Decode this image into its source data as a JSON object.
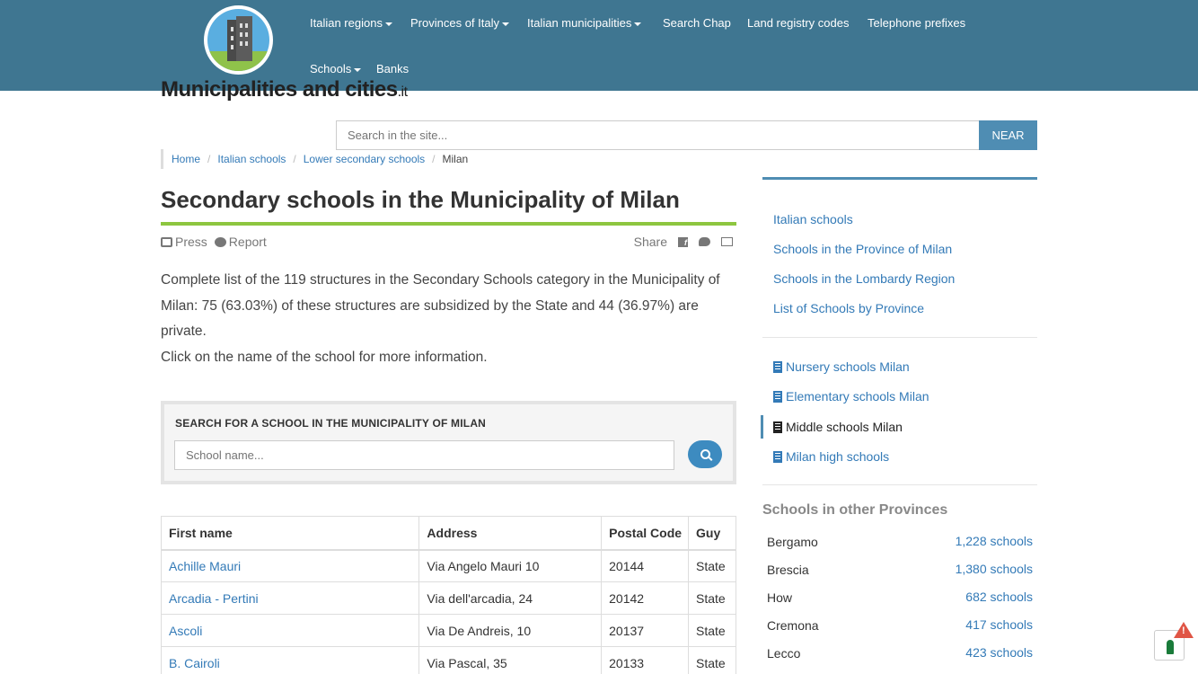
{
  "site": {
    "name": "Municipalities and cities",
    "suffix": ".it"
  },
  "nav": {
    "items": [
      {
        "label": "Italian regions",
        "dropdown": true
      },
      {
        "label": "Provinces of Italy",
        "dropdown": true
      },
      {
        "label": "Italian municipalities",
        "dropdown": true
      },
      {
        "label": "Search Chap",
        "dropdown": false
      },
      {
        "label": "Land registry codes",
        "dropdown": false
      },
      {
        "label": "Telephone prefixes",
        "dropdown": false
      },
      {
        "label": "Schools",
        "dropdown": true
      },
      {
        "label": "Banks",
        "dropdown": false
      }
    ]
  },
  "search": {
    "placeholder": "Search in the site...",
    "button_label": "NEAR"
  },
  "breadcrumb": {
    "items": [
      "Home",
      "Italian schools",
      "Lower secondary schools"
    ],
    "current": "Milan"
  },
  "page": {
    "title": "Secondary schools in the Municipality of Milan",
    "tools": {
      "press": "Press",
      "report": "Report",
      "share": "Share"
    },
    "intro_line1": "Complete list of the 119 structures in the Secondary Schools category in the Municipality of Milan: 75 (63.03%) of these structures are subsidized by the State and 44 (36.97%) are private.",
    "intro_line2": "Click on the name of the school for more information."
  },
  "school_search": {
    "title": "SEARCH FOR A SCHOOL IN THE MUNICIPALITY OF MILAN",
    "placeholder": "School name..."
  },
  "table": {
    "headers": [
      "First name",
      "Address",
      "Postal Code",
      "Guy"
    ],
    "rows": [
      {
        "name": "Achille Mauri",
        "address": "Via Angelo Mauri 10",
        "postal": "20144",
        "type": "State"
      },
      {
        "name": "Arcadia - Pertini",
        "address": "Via dell'arcadia, 24",
        "postal": "20142",
        "type": "State"
      },
      {
        "name": "Ascoli",
        "address": "Via De Andreis, 10",
        "postal": "20137",
        "type": "State"
      },
      {
        "name": "B. Cairoli",
        "address": "Via Pascal, 35",
        "postal": "20133",
        "type": "State"
      }
    ]
  },
  "sidebar": {
    "links": [
      "Italian schools",
      "Schools in the Province of Milan",
      "Schools in the Lombardy Region",
      "List of Schools by Province"
    ],
    "school_types": [
      {
        "label": "Nursery schools Milan",
        "active": false
      },
      {
        "label": "Elementary schools Milan",
        "active": false
      },
      {
        "label": "Middle schools Milan",
        "active": true
      },
      {
        "label": "Milan high schools",
        "active": false
      }
    ],
    "other_title": "Schools in other Provinces",
    "provinces": [
      {
        "name": "Bergamo",
        "count": "1,228 schools"
      },
      {
        "name": "Brescia",
        "count": "1,380 schools"
      },
      {
        "name": "How",
        "count": "682 schools"
      },
      {
        "name": "Cremona",
        "count": "417 schools"
      },
      {
        "name": "Lecco",
        "count": "423 schools"
      }
    ]
  },
  "colors": {
    "header_bg": "#3f7691",
    "accent_green": "#8dc63f",
    "link_blue": "#337ab7",
    "button_blue": "#4f8db3"
  }
}
